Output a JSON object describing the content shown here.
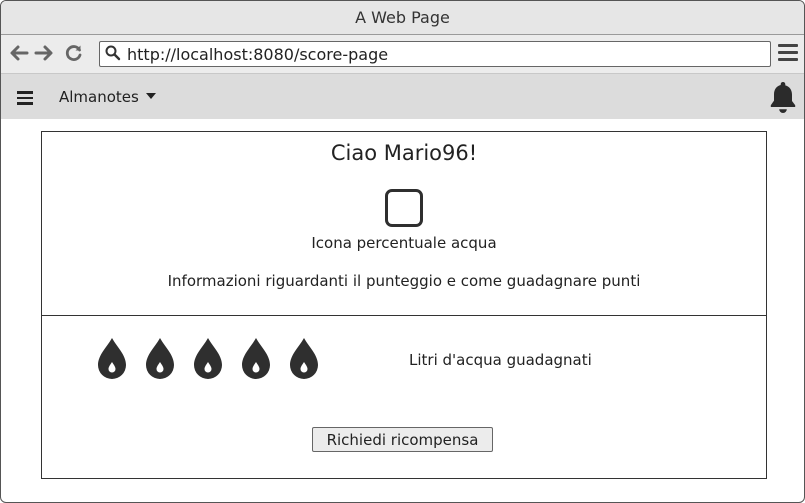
{
  "window": {
    "title": "A Web Page"
  },
  "browser": {
    "url": "http://localhost:8080/score-page",
    "back_icon": "arrow-left-icon",
    "forward_icon": "arrow-right-icon",
    "reload_icon": "reload-icon"
  },
  "appbar": {
    "title": "Almanotes",
    "menu_icon": "hamburger-icon",
    "notification_icon": "bell-icon"
  },
  "main": {
    "greeting": "Ciao Mario96!",
    "water_icon_caption": "Icona percentuale acqua",
    "info_text": "Informazioni riguardanti il punteggio e come guadagnare punti",
    "drops_count": 5,
    "liters_label": "Litri d'acqua guadagnati",
    "reward_button_label": "Richiedi ricompensa"
  },
  "colors": {
    "drop": "#2f2f2f",
    "appbar_bg": "#dcdcdc"
  }
}
